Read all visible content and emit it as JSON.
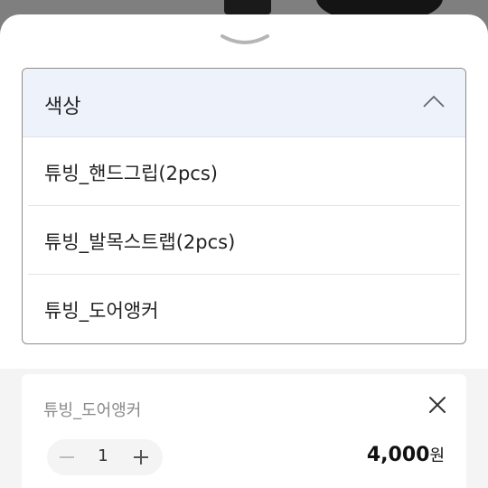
{
  "option_sheet": {
    "dropdown": {
      "title": "색상",
      "expanded": true,
      "options": [
        {
          "label": "튜빙_핸드그립(2pcs)"
        },
        {
          "label": "튜빙_발목스트랩(2pcs)"
        },
        {
          "label": "튜빙_도어앵커"
        }
      ]
    },
    "selected_item": {
      "name": "튜빙_도어앵커",
      "quantity": "1",
      "price": "4,000",
      "currency": "원"
    }
  },
  "icons": {
    "handle": "chevron-down-icon",
    "dropdown_toggle": "chevron-up-icon",
    "close": "close-icon",
    "minus": "minus-icon",
    "plus": "plus-icon"
  },
  "colors": {
    "dropdown_header_bg": "#eef3fb",
    "backdrop": "#7f7f7f",
    "summary_bg": "#f4f4f4"
  }
}
